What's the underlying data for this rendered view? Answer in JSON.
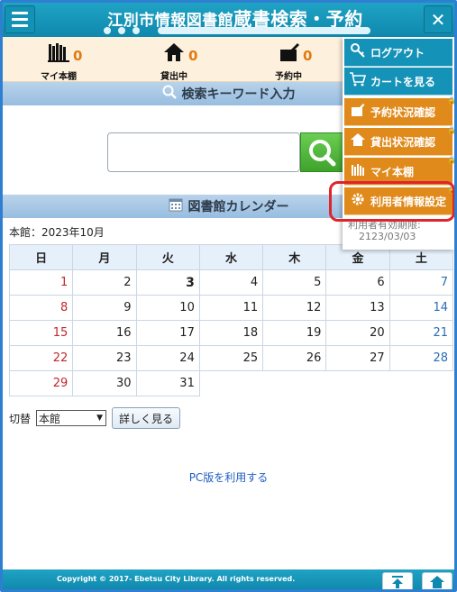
{
  "header": {
    "title_part1": "江別市情報図書館",
    "title_part2": "蔵書検索・予約",
    "close_label": "✕"
  },
  "status": [
    {
      "icon": "bookshelf-icon",
      "glyph": "𝍢",
      "count": "0",
      "label": "マイ本棚"
    },
    {
      "icon": "house-icon",
      "glyph": "⌂",
      "count": "0",
      "label": "貸出中"
    },
    {
      "icon": "reserve-icon",
      "glyph": "✎",
      "count": "0",
      "label": "予約中"
    }
  ],
  "search": {
    "heading": "検索キーワード入力",
    "placeholder": ""
  },
  "calendar": {
    "heading": "図書館カレンダー",
    "month_label": "本館：2023年10月",
    "weekdays": [
      "日",
      "月",
      "火",
      "水",
      "木",
      "金",
      "土"
    ],
    "weeks": [
      [
        "1",
        "2",
        "3",
        "4",
        "5",
        "6",
        "7"
      ],
      [
        "8",
        "9",
        "10",
        "11",
        "12",
        "13",
        "14"
      ],
      [
        "15",
        "16",
        "17",
        "18",
        "19",
        "20",
        "21"
      ],
      [
        "22",
        "23",
        "24",
        "25",
        "26",
        "27",
        "28"
      ],
      [
        "29",
        "30",
        "31",
        "",
        "",
        "",
        ""
      ]
    ],
    "switch_label": "切替",
    "switch_value": "本館",
    "detail_button": "詳しく見る"
  },
  "pc_link": "PC版を利用する",
  "footer": {
    "copyright": "Copyright © 2017- Ebetsu City Library. All rights reserved."
  },
  "menu": {
    "items": [
      {
        "label": "ログアウト",
        "icon": "key-icon",
        "glyph": "🔑",
        "color": "blue"
      },
      {
        "label": "カートを見る",
        "icon": "cart-icon",
        "glyph": "🛒",
        "color": "blue"
      },
      {
        "label": "予約状況確認",
        "icon": "reserve-icon",
        "glyph": "✎",
        "color": "orange"
      },
      {
        "label": "貸出状況確認",
        "icon": "house-icon",
        "glyph": "⌂",
        "color": "orange"
      },
      {
        "label": "マイ本棚",
        "icon": "bookshelf-icon",
        "glyph": "𝍢",
        "color": "orange"
      },
      {
        "label": "利用者情報設定",
        "icon": "gear-icon",
        "glyph": "⚙",
        "color": "orange"
      }
    ],
    "expiry_label": "利用者有効期限:",
    "expiry_date": "2123/03/03"
  },
  "colors": {
    "header": "#1592b7",
    "accent_orange": "#e08a1c",
    "highlight": "#e0242b"
  }
}
